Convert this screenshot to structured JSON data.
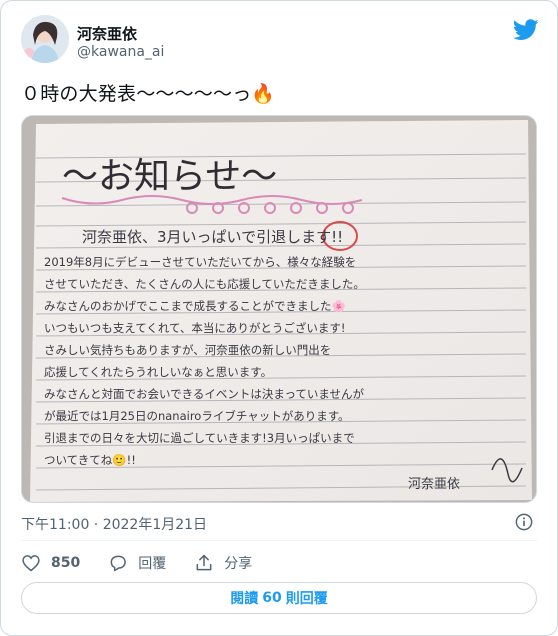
{
  "author": {
    "name": "河奈亜依",
    "handle": "@kawana_ai"
  },
  "tweet": {
    "text": "０時の大発表〜〜〜〜〜っ🔥"
  },
  "media": {
    "letter_title": "〜お知らせ〜",
    "lines": [
      "河奈亜依、3月いっぱいで引退します!!",
      "2019年8月にデビューさせていただいてから、様々な経験を",
      "させていただき、たくさんの人にも応援していただきました。",
      "みなさんのおかげでここまで成長することができました🌸",
      "いつもいつも支えてくれて、本当にありがとうございます!",
      "さみしい気持ちもありますが、河奈亜依の新しい門出を",
      "応援してくれたらうれしいなぁと思います。",
      "みなさんと対面でお会いできるイベントは決まっていませんが",
      "が最近では1月25日のnanairoライブチャットがあります。",
      "引退までの日々を大切に過ごしていきます!3月いっぱいまで",
      "ついてきてね🙂!!"
    ],
    "signature": "河奈亜依"
  },
  "timestamp": "下午11:00 · 2022年1月21日",
  "actions": {
    "likes": "850",
    "reply_label": "回覆",
    "share_label": "分享"
  },
  "replies_button": {
    "prefix": "閱讀",
    "count": "60",
    "suffix": "則回覆"
  },
  "colors": {
    "brand": "#1d9bf0",
    "text": "#0f1419",
    "muted": "#536471",
    "border": "#cfd9de"
  },
  "icons": [
    "twitter-bird-icon",
    "info-icon",
    "heart-icon",
    "reply-icon",
    "share-icon"
  ]
}
